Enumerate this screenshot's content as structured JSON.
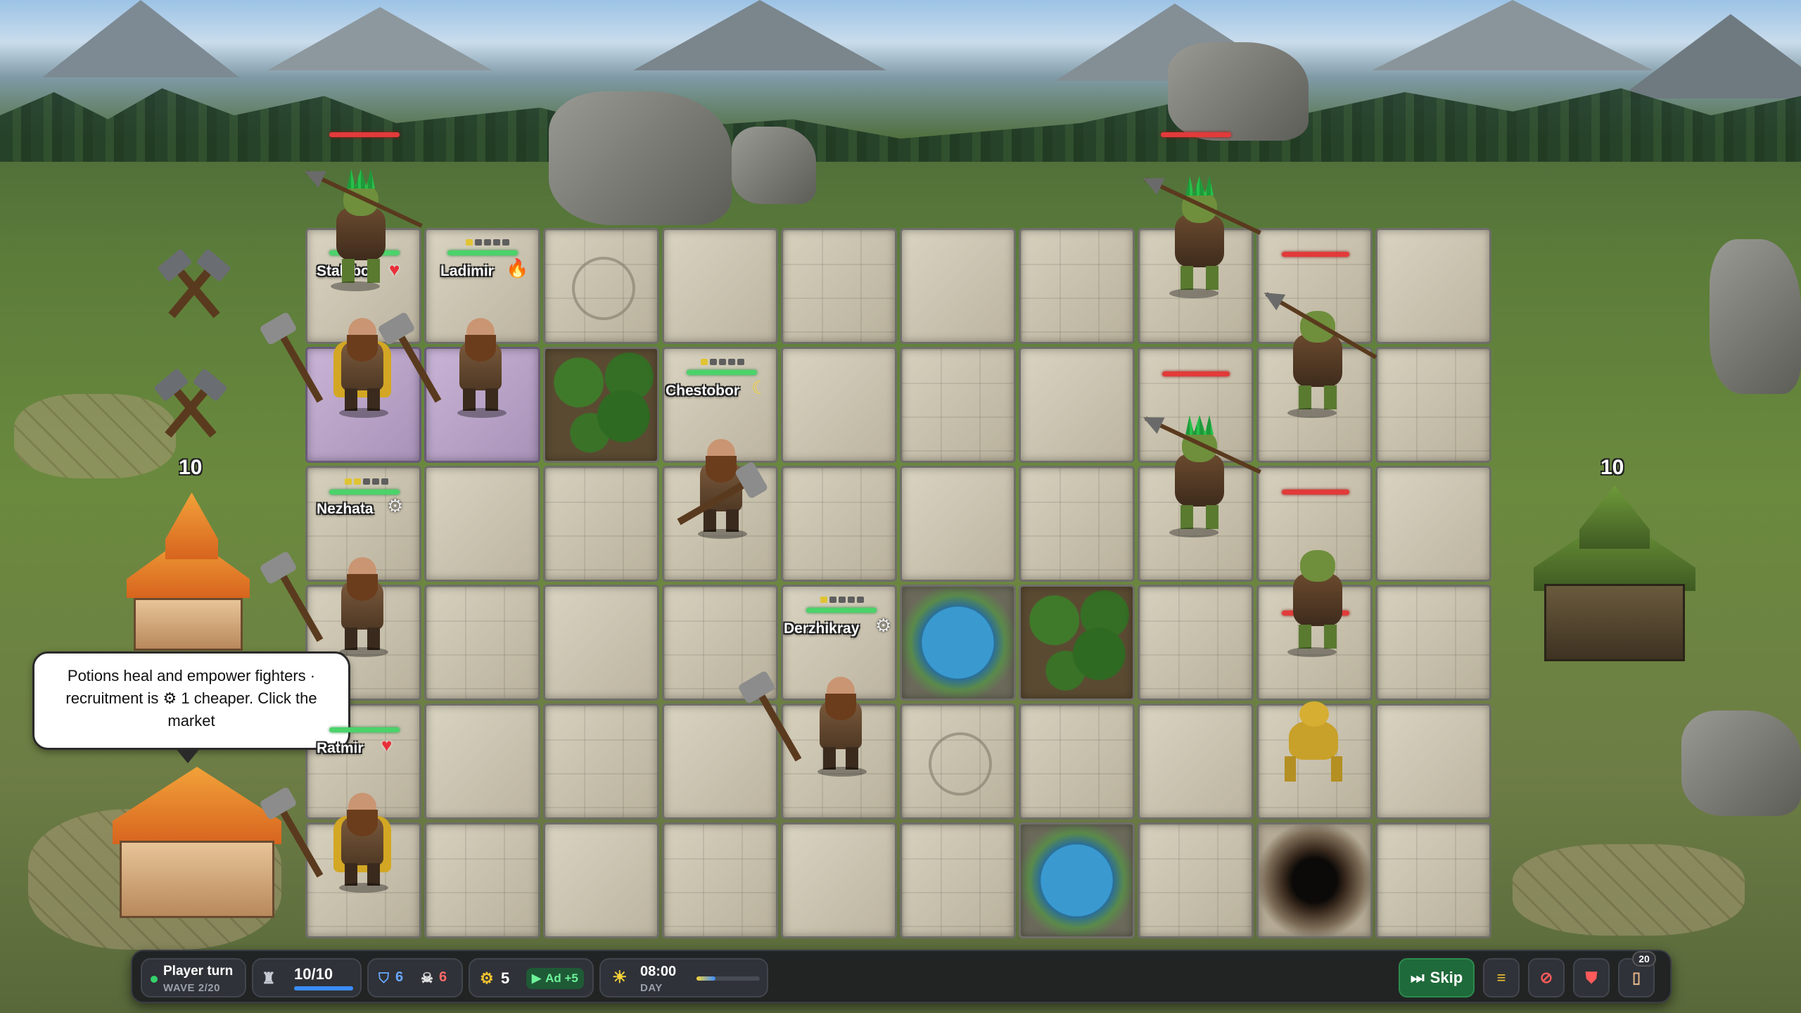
{
  "units": {
    "stalebor": {
      "name": "Stalebor",
      "status_icon": "heart-icon"
    },
    "ladimir": {
      "name": "Ladimir",
      "status_icon": "fire-icon"
    },
    "chestobor": {
      "name": "Chestobor",
      "status_icon": "moon-icon"
    },
    "nezhata": {
      "name": "Nezhata",
      "status_icon": "gear-icon"
    },
    "derzhikray": {
      "name": "Derzhikray",
      "status_icon": "gear-icon"
    },
    "ratmir": {
      "name": "Ratmir",
      "status_icon": "heart-icon"
    }
  },
  "player_castle_hp": "10",
  "enemy_castle_hp": "10",
  "tooltip": {
    "text": "Potions heal and empower fighters · recruitment is ⚙ 1 cheaper. Click the market"
  },
  "hud": {
    "turn_label": "Player turn",
    "wave_label": "WAVE 2/20",
    "population": "10/10",
    "population_fraction": 1.0,
    "shields": "6",
    "kills": "6",
    "gears": "5",
    "ad_label": "Ad +5",
    "time": "08:00",
    "time_of_day": "DAY",
    "day_progress_fraction": 0.3,
    "skip_label": "Skip",
    "deck_count": "20"
  },
  "colors": {
    "hp_ally": "#4bd36a",
    "hp_enemy": "#e23a3a",
    "accent_blue": "#3b8cff",
    "skip_green": "#1f6a3a"
  }
}
